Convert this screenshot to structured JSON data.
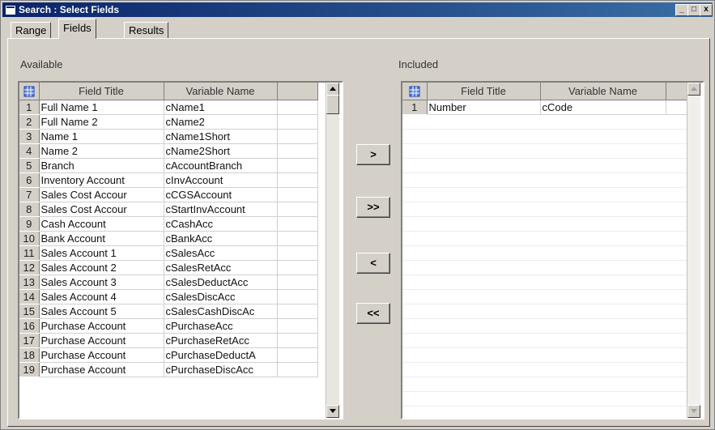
{
  "window": {
    "title": "Search : Select Fields"
  },
  "title_buttons": {
    "minimize": "_",
    "maximize": "□",
    "close": "x"
  },
  "tabs": [
    {
      "label": "Range"
    },
    {
      "label": "Fields",
      "active": true
    },
    {
      "label": "Results"
    }
  ],
  "available": {
    "label": "Available",
    "columns": [
      "Field Title",
      "Variable Name"
    ],
    "rows": [
      {
        "num": "1",
        "title": "Full Name 1",
        "variable": "cName1"
      },
      {
        "num": "2",
        "title": "Full Name 2",
        "variable": "cName2"
      },
      {
        "num": "3",
        "title": "Name 1",
        "variable": "cName1Short"
      },
      {
        "num": "4",
        "title": "Name 2",
        "variable": "cName2Short"
      },
      {
        "num": "5",
        "title": "Branch",
        "variable": "cAccountBranch"
      },
      {
        "num": "6",
        "title": "Inventory Account",
        "variable": "cInvAccount"
      },
      {
        "num": "7",
        "title": "Sales Cost Accour",
        "variable": "cCGSAccount"
      },
      {
        "num": "8",
        "title": "Sales Cost Accour",
        "variable": "cStartInvAccount"
      },
      {
        "num": "9",
        "title": "Cash Account",
        "variable": "cCashAcc"
      },
      {
        "num": "10",
        "title": "Bank Account",
        "variable": "cBankAcc"
      },
      {
        "num": "11",
        "title": "Sales Account 1",
        "variable": "cSalesAcc"
      },
      {
        "num": "12",
        "title": "Sales Account 2",
        "variable": "cSalesRetAcc"
      },
      {
        "num": "13",
        "title": "Sales Account 3",
        "variable": "cSalesDeductAcc"
      },
      {
        "num": "14",
        "title": "Sales Account 4",
        "variable": "cSalesDiscAcc"
      },
      {
        "num": "15",
        "title": "Sales Account 5",
        "variable": "cSalesCashDiscAc"
      },
      {
        "num": "16",
        "title": "Purchase Account",
        "variable": "cPurchaseAcc"
      },
      {
        "num": "17",
        "title": "Purchase Account",
        "variable": "cPurchaseRetAcc"
      },
      {
        "num": "18",
        "title": "Purchase Account",
        "variable": "cPurchaseDeductA"
      },
      {
        "num": "19",
        "title": "Purchase Account",
        "variable": "cPurchaseDiscAcc"
      }
    ]
  },
  "included": {
    "label": "Included",
    "columns": [
      "Field Title",
      "Variable Name"
    ],
    "rows": [
      {
        "num": "1",
        "title": "Number",
        "variable": "cCode"
      }
    ]
  },
  "move_buttons": {
    "add": ">",
    "add_all": ">>",
    "remove": "<",
    "remove_all": "<<"
  },
  "icons": {
    "corner": "table-grid-icon",
    "up": "scroll-up-arrow-icon",
    "down": "scroll-down-arrow-icon"
  },
  "colors": {
    "titlebar_start": "#0a246a",
    "titlebar_end": "#3a6ea5",
    "face": "#d4d0c8"
  }
}
